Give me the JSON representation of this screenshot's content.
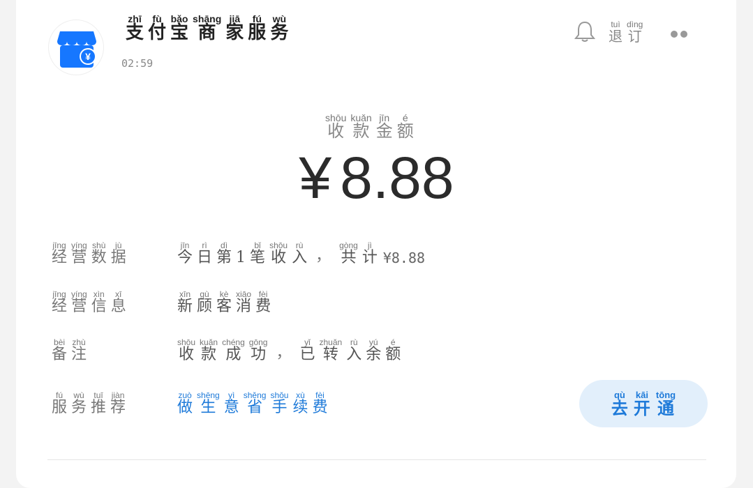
{
  "header": {
    "title": [
      {
        "py": "zhī",
        "ch": "支"
      },
      {
        "py": "fù",
        "ch": "付"
      },
      {
        "py": "bǎo",
        "ch": "宝"
      },
      {
        "py": "shāng",
        "ch": "商"
      },
      {
        "py": "jiā",
        "ch": "家"
      },
      {
        "py": "fú",
        "ch": "服"
      },
      {
        "py": "wù",
        "ch": "务"
      }
    ],
    "time": "02:59",
    "refund": [
      {
        "py": "tuì",
        "ch": "退"
      },
      {
        "py": "dìng",
        "ch": "订"
      }
    ],
    "icons": {
      "avatar": "store-yuan-icon",
      "bell": "bell-icon",
      "more": "more-icon"
    },
    "brand_color": "#1e7ad9"
  },
  "amount": {
    "label": [
      {
        "py": "shōu",
        "ch": "收"
      },
      {
        "py": "kuǎn",
        "ch": "款"
      },
      {
        "py": "jīn",
        "ch": "金"
      },
      {
        "py": "é",
        "ch": "额"
      }
    ],
    "currency": "¥",
    "value": "8.88"
  },
  "rows": {
    "r1": {
      "label": [
        {
          "py": "jīng",
          "ch": "经"
        },
        {
          "py": "yíng",
          "ch": "营"
        },
        {
          "py": "shù",
          "ch": "数"
        },
        {
          "py": "jù",
          "ch": "据"
        }
      ],
      "value_a": [
        {
          "py": "jīn",
          "ch": "今"
        },
        {
          "py": "rì",
          "ch": "日"
        },
        {
          "py": "dì",
          "ch": "第"
        },
        {
          "py": "",
          "ch": "1"
        },
        {
          "py": "bǐ",
          "ch": "笔"
        },
        {
          "py": "shōu",
          "ch": "收"
        },
        {
          "py": "rù",
          "ch": "入"
        }
      ],
      "punct": "，",
      "value_b": [
        {
          "py": "gòng",
          "ch": "共"
        },
        {
          "py": "jì",
          "ch": "计"
        }
      ],
      "total": "¥8.88"
    },
    "r2": {
      "label": [
        {
          "py": "jīng",
          "ch": "经"
        },
        {
          "py": "yíng",
          "ch": "营"
        },
        {
          "py": "xìn",
          "ch": "信"
        },
        {
          "py": "xī",
          "ch": "息"
        }
      ],
      "value": [
        {
          "py": "xīn",
          "ch": "新"
        },
        {
          "py": "gù",
          "ch": "顾"
        },
        {
          "py": "kè",
          "ch": "客"
        },
        {
          "py": "xiāo",
          "ch": "消"
        },
        {
          "py": "fèi",
          "ch": "费"
        }
      ]
    },
    "r3": {
      "label": [
        {
          "py": "bèi",
          "ch": "备"
        },
        {
          "py": "zhù",
          "ch": "注"
        }
      ],
      "value_a": [
        {
          "py": "shōu",
          "ch": "收"
        },
        {
          "py": "kuǎn",
          "ch": "款"
        },
        {
          "py": "chéng",
          "ch": "成"
        },
        {
          "py": "gōng",
          "ch": "功"
        }
      ],
      "punct": "，",
      "value_b": [
        {
          "py": "yǐ",
          "ch": "已"
        },
        {
          "py": "zhuǎn",
          "ch": "转"
        },
        {
          "py": "rù",
          "ch": "入"
        },
        {
          "py": "yú",
          "ch": "余"
        },
        {
          "py": "é",
          "ch": "额"
        }
      ]
    },
    "r4": {
      "label": [
        {
          "py": "fú",
          "ch": "服"
        },
        {
          "py": "wù",
          "ch": "务"
        },
        {
          "py": "tuī",
          "ch": "推"
        },
        {
          "py": "jiàn",
          "ch": "荐"
        }
      ],
      "value": [
        {
          "py": "zuò",
          "ch": "做"
        },
        {
          "py": "shēng",
          "ch": "生"
        },
        {
          "py": "yì",
          "ch": "意"
        },
        {
          "py": "shěng",
          "ch": "省"
        },
        {
          "py": "shǒu",
          "ch": "手"
        },
        {
          "py": "xù",
          "ch": "续"
        },
        {
          "py": "fèi",
          "ch": "费"
        }
      ]
    }
  },
  "open_button": [
    {
      "py": "qù",
      "ch": "去"
    },
    {
      "py": "kāi",
      "ch": "开"
    },
    {
      "py": "tōng",
      "ch": "通"
    }
  ]
}
